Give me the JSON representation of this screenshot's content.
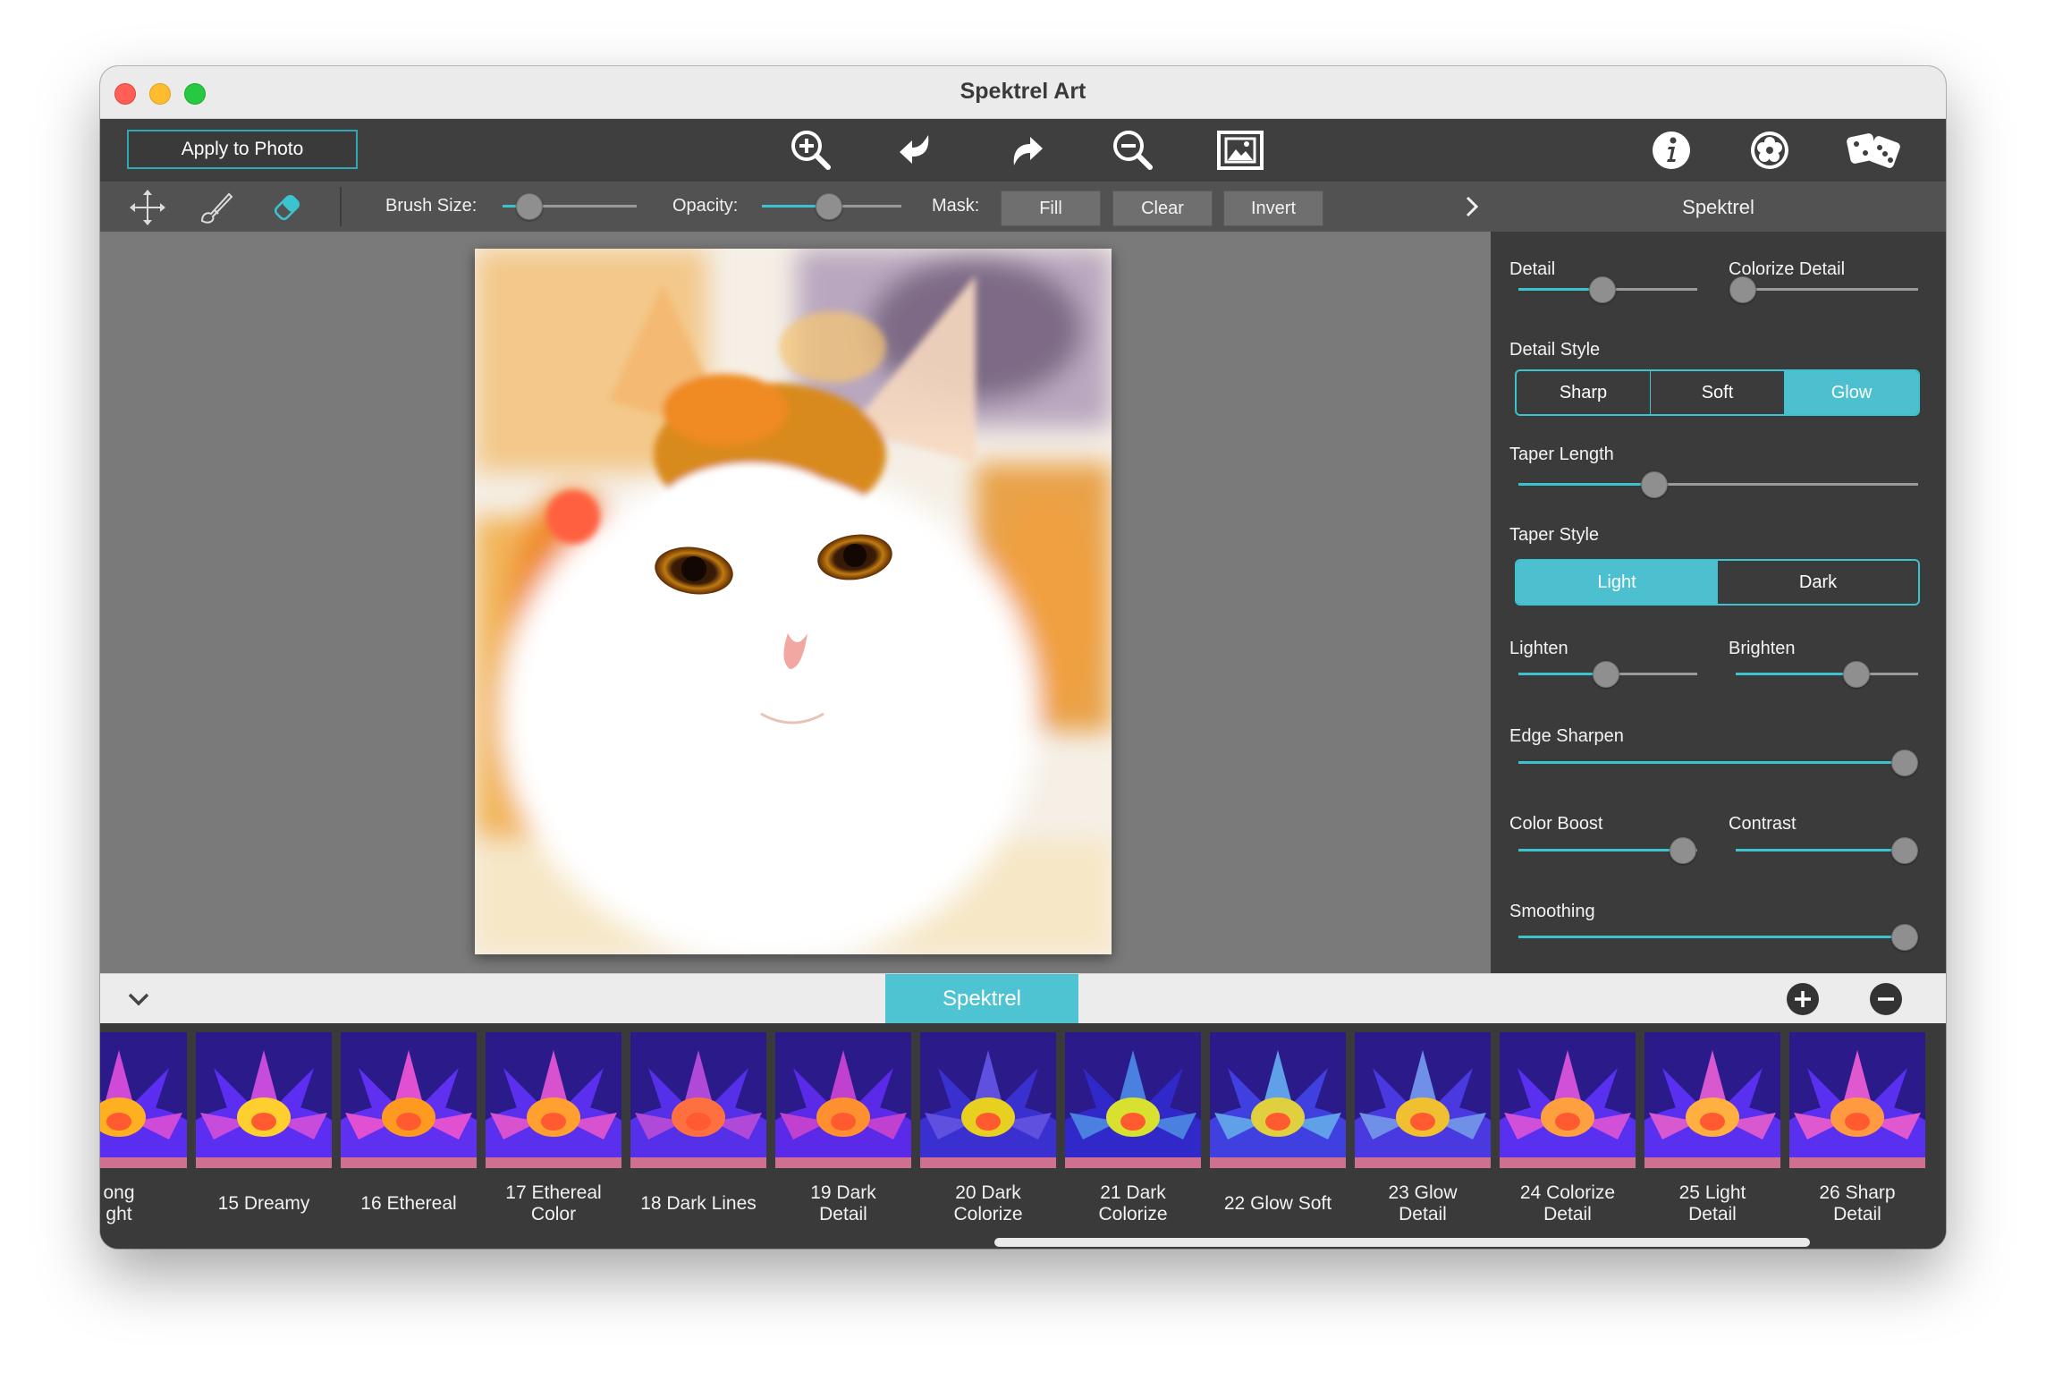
{
  "window": {
    "title": "Spektrel Art"
  },
  "toolbar": {
    "apply_label": "Apply to Photo",
    "icons": [
      "zoom-in-icon",
      "undo-icon",
      "redo-icon",
      "zoom-out-icon",
      "fit-image-icon",
      "info-icon",
      "settings-icon",
      "random-dice-icon"
    ]
  },
  "options": {
    "brush_size_label": "Brush Size:",
    "brush_size_value": 0.2,
    "opacity_label": "Opacity:",
    "opacity_value": 0.48,
    "mask_label": "Mask:",
    "fill_label": "Fill",
    "clear_label": "Clear",
    "invert_label": "Invert"
  },
  "panel": {
    "title": "Spektrel",
    "detail": {
      "label": "Detail",
      "value": 0.47
    },
    "colorize_detail": {
      "label": "Colorize Detail",
      "value": 0.04
    },
    "detail_style": {
      "label": "Detail Style",
      "options": [
        "Sharp",
        "Soft",
        "Glow"
      ],
      "selected": "Glow"
    },
    "taper_length": {
      "label": "Taper Length",
      "value": 0.34
    },
    "taper_style": {
      "label": "Taper Style",
      "options": [
        "Light",
        "Dark"
      ],
      "selected": "Light"
    },
    "lighten": {
      "label": "Lighten",
      "value": 0.49
    },
    "brighten": {
      "label": "Brighten",
      "value": 0.66
    },
    "edge_sharpen": {
      "label": "Edge Sharpen",
      "value": 1.0
    },
    "color_boost": {
      "label": "Color Boost",
      "value": 0.92
    },
    "contrast": {
      "label": "Contrast",
      "value": 1.0
    },
    "smoothing": {
      "label": "Smoothing",
      "value": 1.0
    }
  },
  "bottom": {
    "tab_label": "Spektrel"
  },
  "presets": [
    {
      "line1": "ong",
      "line2": "ght"
    },
    {
      "line1": "15 Dreamy",
      "line2": ""
    },
    {
      "line1": "16 Ethereal",
      "line2": ""
    },
    {
      "line1": "17 Ethereal",
      "line2": "Color"
    },
    {
      "line1": "18 Dark Lines",
      "line2": ""
    },
    {
      "line1": "19 Dark",
      "line2": "Detail"
    },
    {
      "line1": "20 Dark",
      "line2": "Colorize"
    },
    {
      "line1": "21 Dark",
      "line2": "Colorize"
    },
    {
      "line1": "22 Glow Soft",
      "line2": ""
    },
    {
      "line1": "23 Glow",
      "line2": "Detail"
    },
    {
      "line1": "24 Colorize",
      "line2": "Detail"
    },
    {
      "line1": "25 Light",
      "line2": "Detail"
    },
    {
      "line1": "26 Sharp",
      "line2": "Detail"
    }
  ],
  "colors": {
    "accent": "#3cc3d0",
    "tab": "#4ec3d2"
  }
}
